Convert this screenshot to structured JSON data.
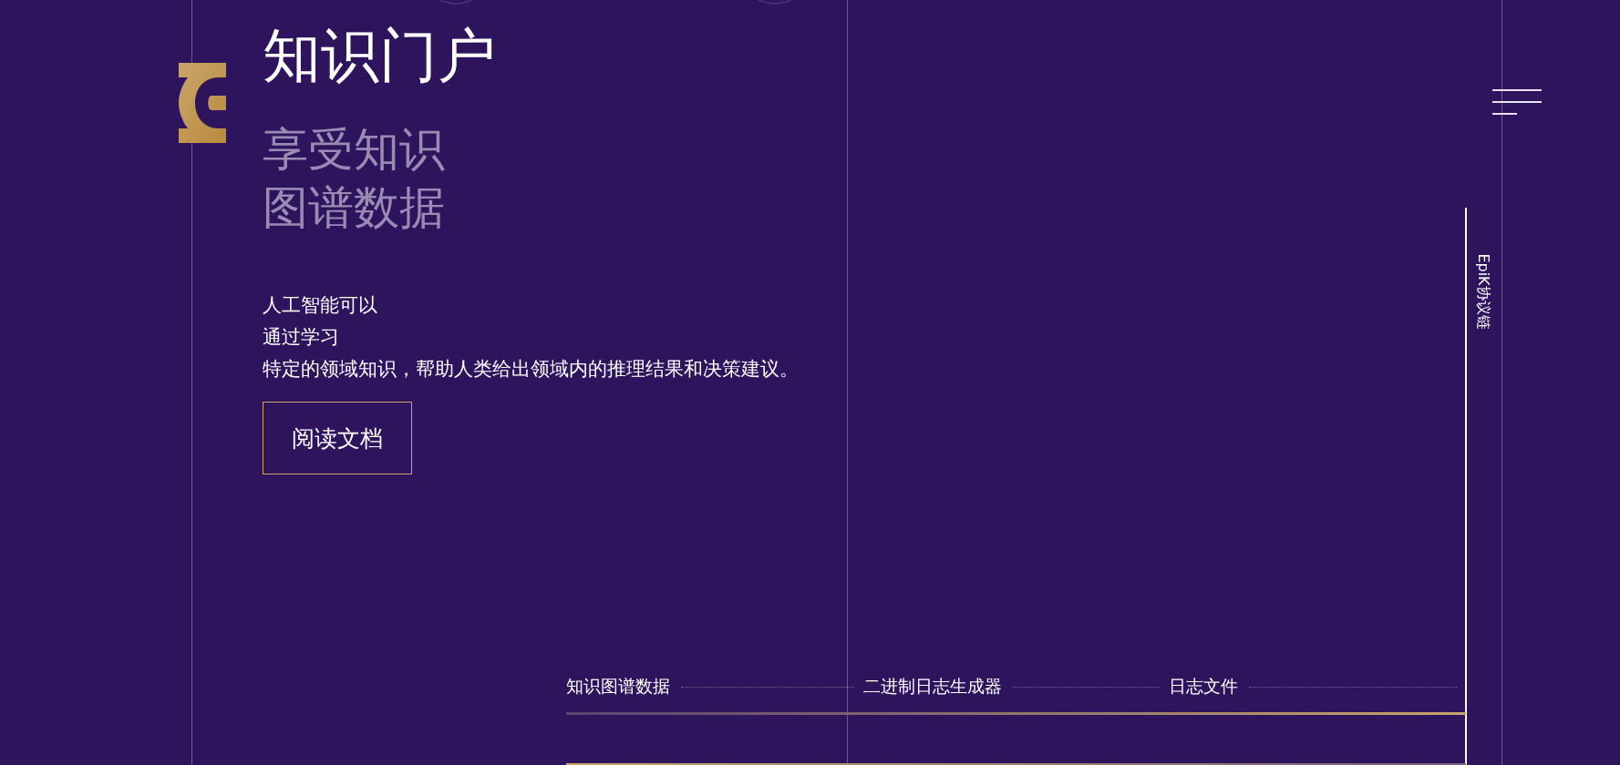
{
  "hero": {
    "title": "知识门户",
    "subtitle_lines": [
      "享受知识",
      "图谱数据"
    ],
    "description_lines": [
      "人工智能可以",
      "通过学习",
      "特定的领域知识，帮助人类给出领域内的推理结果和决策建议。"
    ],
    "button": "阅读文档"
  },
  "side_label": "EpiK协议链",
  "steps": [
    {
      "label": "知识图谱数据"
    },
    {
      "label": "二进制日志生成器"
    },
    {
      "label": "日志文件"
    }
  ]
}
